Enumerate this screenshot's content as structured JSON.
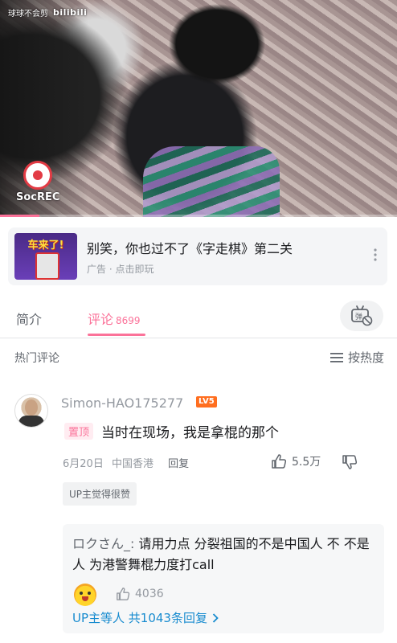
{
  "video": {
    "watermark_text": "球球不会剪",
    "watermark_logo": "bilibili",
    "rec_label": "SocREC",
    "progress": 0.1
  },
  "ad": {
    "thumb_title": "车来了!",
    "title": "别笑，你也过不了《字走棋》第二关",
    "subtitle": "广告 · 点击即玩"
  },
  "tabs": {
    "intro": "简介",
    "comments": "评论",
    "comments_count": "8699"
  },
  "hot": {
    "title": "热门评论",
    "sort_label": "按热度"
  },
  "comment": {
    "username": "Simon-HAO175277",
    "level": "LV5",
    "pinned_tag": "置顶",
    "text": "当时在现场，我是拿棍的那个",
    "date": "6月20日",
    "location": "中国香港",
    "reply_label": "回复",
    "likes": "5.5万",
    "up_badge": "UP主觉得很赞"
  },
  "reply": {
    "author": "ロクさん_:",
    "text": " 请用力点 分裂祖国的不是中国人 不 不是人 为港警舞棍力度打call",
    "likes": "4036",
    "more": "UP主等人 共1043条回复"
  }
}
